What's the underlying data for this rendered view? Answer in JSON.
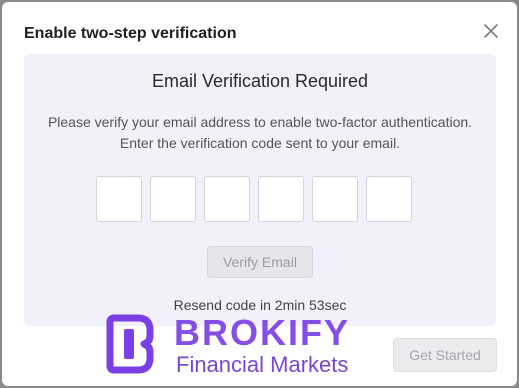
{
  "dialog": {
    "title": "Enable two-step verification",
    "close_icon": "close-icon"
  },
  "verification": {
    "heading": "Email Verification Required",
    "description_line1": "Please verify your email address to enable two-factor authentication.",
    "description_line2": "Enter the verification code sent to your email.",
    "code_digits": [
      "",
      "",
      "",
      "",
      "",
      ""
    ],
    "verify_button": "Verify Email",
    "resend_text": "Resend code in 2min 53sec"
  },
  "footer": {
    "get_started_button": "Get Started"
  },
  "watermark": {
    "brand": "BROKIFY",
    "tagline": "Financial Markets"
  },
  "colors": {
    "panel_bg": "#f1f0fb",
    "watermark": "#7a40e6",
    "disabled_button_text": "#9a9aa3"
  }
}
